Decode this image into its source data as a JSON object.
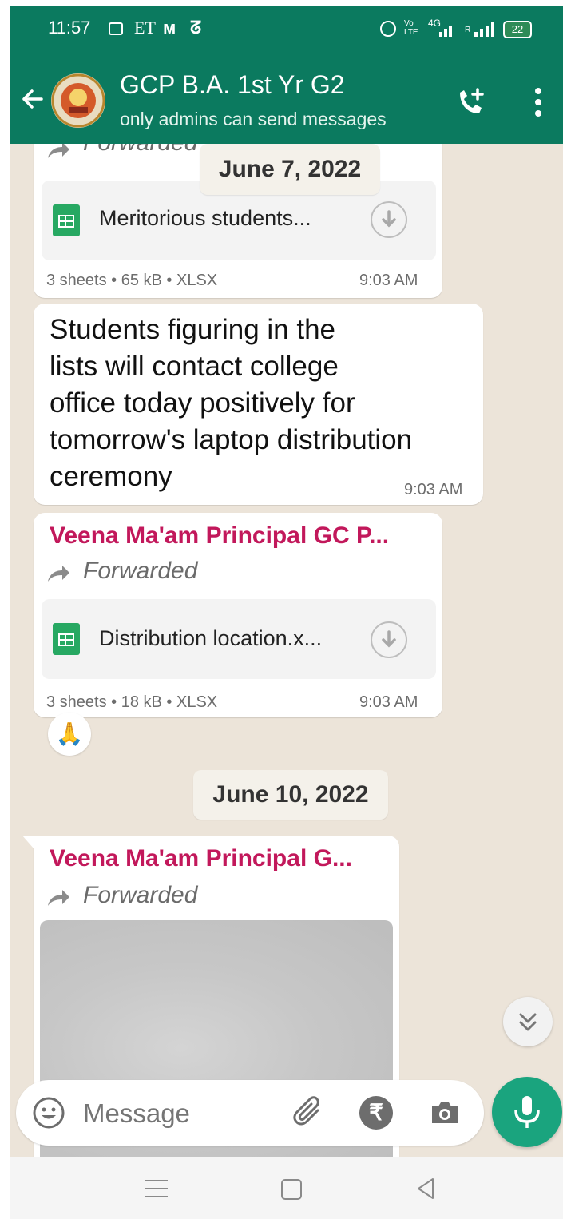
{
  "status_bar": {
    "time": "11:57",
    "carrier_mark": "ET",
    "network_label": "4G",
    "volte": "Vo LTE",
    "roaming": "R",
    "battery": "22"
  },
  "header": {
    "title": "GCP B.A. 1st Yr G2",
    "subtitle": "only admins can send messages"
  },
  "messages": [
    {
      "forwarded": "Forwarded",
      "doc_name": "Meritorious students...",
      "meta": "3 sheets • 65 kB • XLSX",
      "time": "9:03 AM"
    },
    {
      "text_lines": [
        "Students figuring in the",
        "lists will contact college",
        "office today positively for",
        "tomorrow's laptop distribution",
        "ceremony"
      ],
      "time": "9:03 AM"
    },
    {
      "sender": "Veena Ma'am Principal GC P...",
      "forwarded": "Forwarded",
      "doc_name": "Distribution location.x...",
      "meta": "3 sheets • 18 kB • XLSX",
      "time": "9:03 AM",
      "reaction": "🙏"
    },
    {
      "sender": "Veena Ma'am Principal G...",
      "forwarded": "Forwarded"
    }
  ],
  "dates": [
    "June 7, 2022",
    "June 10, 2022"
  ],
  "composer": {
    "placeholder": "Message",
    "currency_symbol": "₹"
  },
  "colors": {
    "header": "#0b7a5f",
    "sender": "#c2185b",
    "mic_button": "#1aa47e",
    "chat_background": "#ece4d9"
  },
  "icons": [
    "back-arrow-icon",
    "group-avatar",
    "add-call-icon",
    "more-options-icon",
    "forward-arrow-icon",
    "spreadsheet-icon",
    "download-icon",
    "scroll-down-icon",
    "emoji-icon",
    "attach-icon",
    "payment-icon",
    "camera-icon",
    "mic-icon",
    "menu-icon",
    "home-icon",
    "back-icon"
  ]
}
